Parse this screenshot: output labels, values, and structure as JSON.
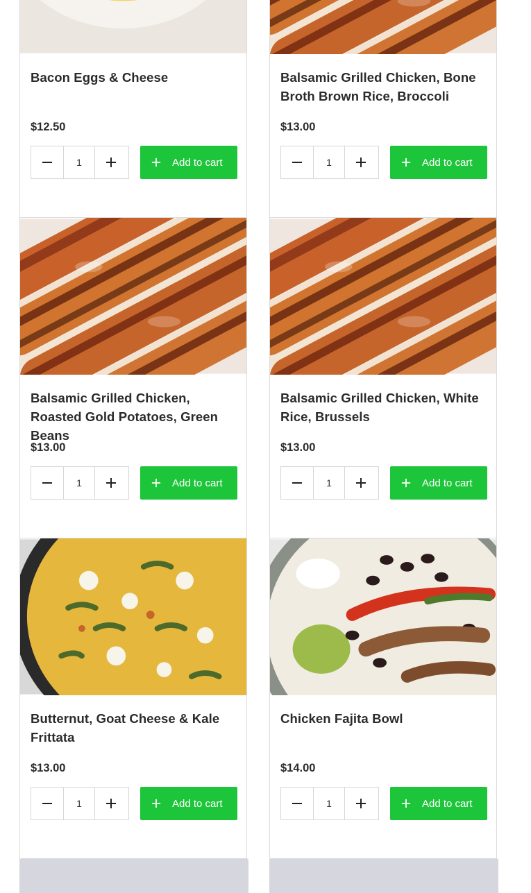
{
  "add_to_cart_label": "Add to cart",
  "accent_color": "#1dc53a",
  "products": [
    {
      "name": "Bacon Eggs & Cheese",
      "price": "$12.50",
      "quantity": "1",
      "image": "scrambled-eggs-bowl"
    },
    {
      "name": "Balsamic Grilled Chicken, Bone Broth Brown Rice, Broccoli",
      "price": "$13.00",
      "quantity": "1",
      "image": "grilled-chicken"
    },
    {
      "name": "Balsamic Grilled Chicken, Roasted Gold Potatoes, Green Beans",
      "price": "$13.00",
      "quantity": "1",
      "image": "grilled-chicken"
    },
    {
      "name": "Balsamic Grilled Chicken, White Rice, Brussels",
      "price": "$13.00",
      "quantity": "1",
      "image": "grilled-chicken"
    },
    {
      "name": "Butternut, Goat Cheese & Kale Frittata",
      "price": "$13.00",
      "quantity": "1",
      "image": "frittata-skillet"
    },
    {
      "name": "Chicken Fajita Bowl",
      "price": "$14.00",
      "quantity": "1",
      "image": "fajita-bowl"
    }
  ]
}
